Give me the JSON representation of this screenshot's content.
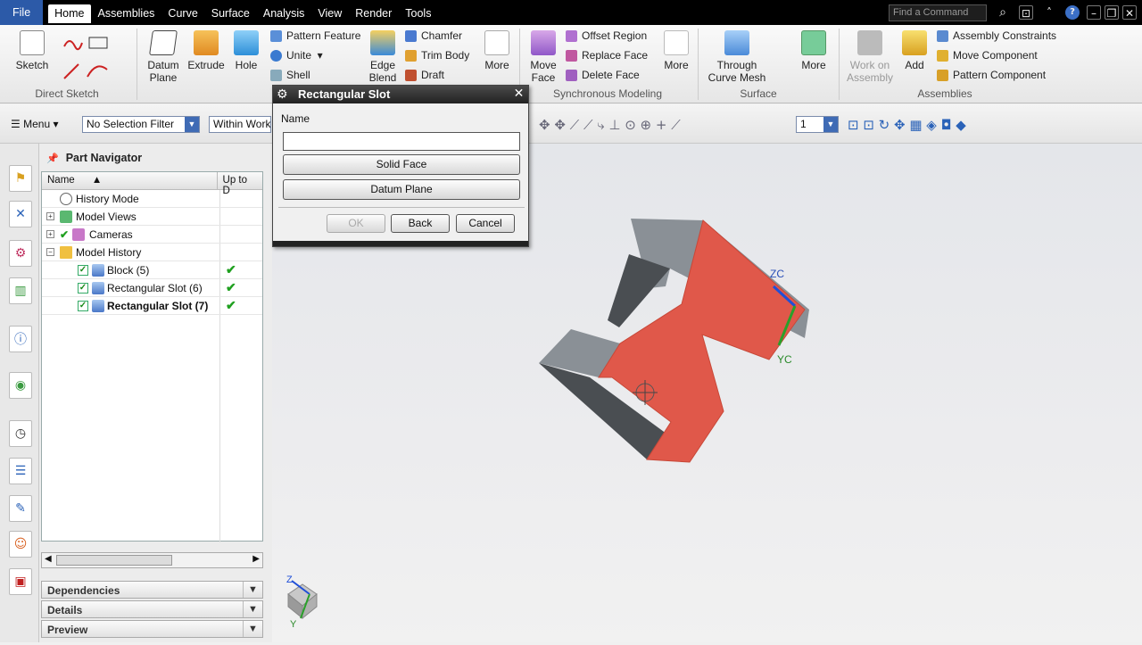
{
  "menubar": {
    "tabs": [
      "File",
      "Home",
      "Assemblies",
      "Curve",
      "Surface",
      "Analysis",
      "View",
      "Render",
      "Tools"
    ],
    "active_tab": "Home",
    "find_placeholder": "Find a Command"
  },
  "ribbon": {
    "direct_sketch": {
      "sketch": "Sketch",
      "group": "Direct Sketch"
    },
    "feature": {
      "datum_plane": "Datum Plane",
      "extrude": "Extrude",
      "hole": "Hole",
      "pattern_feature": "Pattern Feature",
      "unite": "Unite",
      "shell": "Shell",
      "edge_blend": "Edge Blend",
      "chamfer": "Chamfer",
      "trim_body": "Trim Body",
      "draft": "Draft",
      "more": "More"
    },
    "synchronous": {
      "move_face": "Move Face",
      "offset_region": "Offset Region",
      "replace_face": "Replace Face",
      "delete_face": "Delete Face",
      "more": "More",
      "group": "Synchronous Modeling"
    },
    "surface": {
      "through_curve_mesh": "Through Curve Mesh",
      "more": "More",
      "group": "Surface"
    },
    "assemblies": {
      "work_on_assembly": "Work on Assembly",
      "add": "Add",
      "assembly_constraints": "Assembly Constraints",
      "move_component": "Move Component",
      "pattern_component": "Pattern Component",
      "group": "Assemblies"
    }
  },
  "toolbar": {
    "menu": "Menu",
    "selection_filter": "No Selection Filter",
    "scope": "Within Work P",
    "layer_value": "1"
  },
  "part_navigator": {
    "title": "Part Navigator",
    "col_name": "Name",
    "col_uptodate": "Up to D",
    "rows": [
      {
        "label": "History Mode",
        "bold": false,
        "uptodate": ""
      },
      {
        "label": "Model Views",
        "bold": false,
        "uptodate": ""
      },
      {
        "label": "Cameras",
        "bold": false,
        "uptodate": ""
      },
      {
        "label": "Model History",
        "bold": false,
        "uptodate": ""
      },
      {
        "label": "Block (5)",
        "bold": false,
        "uptodate": "✔"
      },
      {
        "label": "Rectangular Slot (6)",
        "bold": false,
        "uptodate": "✔"
      },
      {
        "label": "Rectangular Slot (7)",
        "bold": true,
        "uptodate": "✔"
      }
    ],
    "panes": [
      "Dependencies",
      "Details",
      "Preview"
    ]
  },
  "dialog": {
    "title": "Rectangular Slot",
    "name_label": "Name",
    "name_value": "",
    "solid_face": "Solid Face",
    "datum_plane": "Datum Plane",
    "ok": "OK",
    "back": "Back",
    "cancel": "Cancel"
  },
  "viewport": {
    "axis_zc": "ZC",
    "axis_yc": "YC",
    "triad_z": "Z",
    "triad_y": "Y",
    "colors": {
      "top_face": "#e0584a",
      "side_face": "#8a9096",
      "dark_side": "#4a4e52"
    }
  }
}
